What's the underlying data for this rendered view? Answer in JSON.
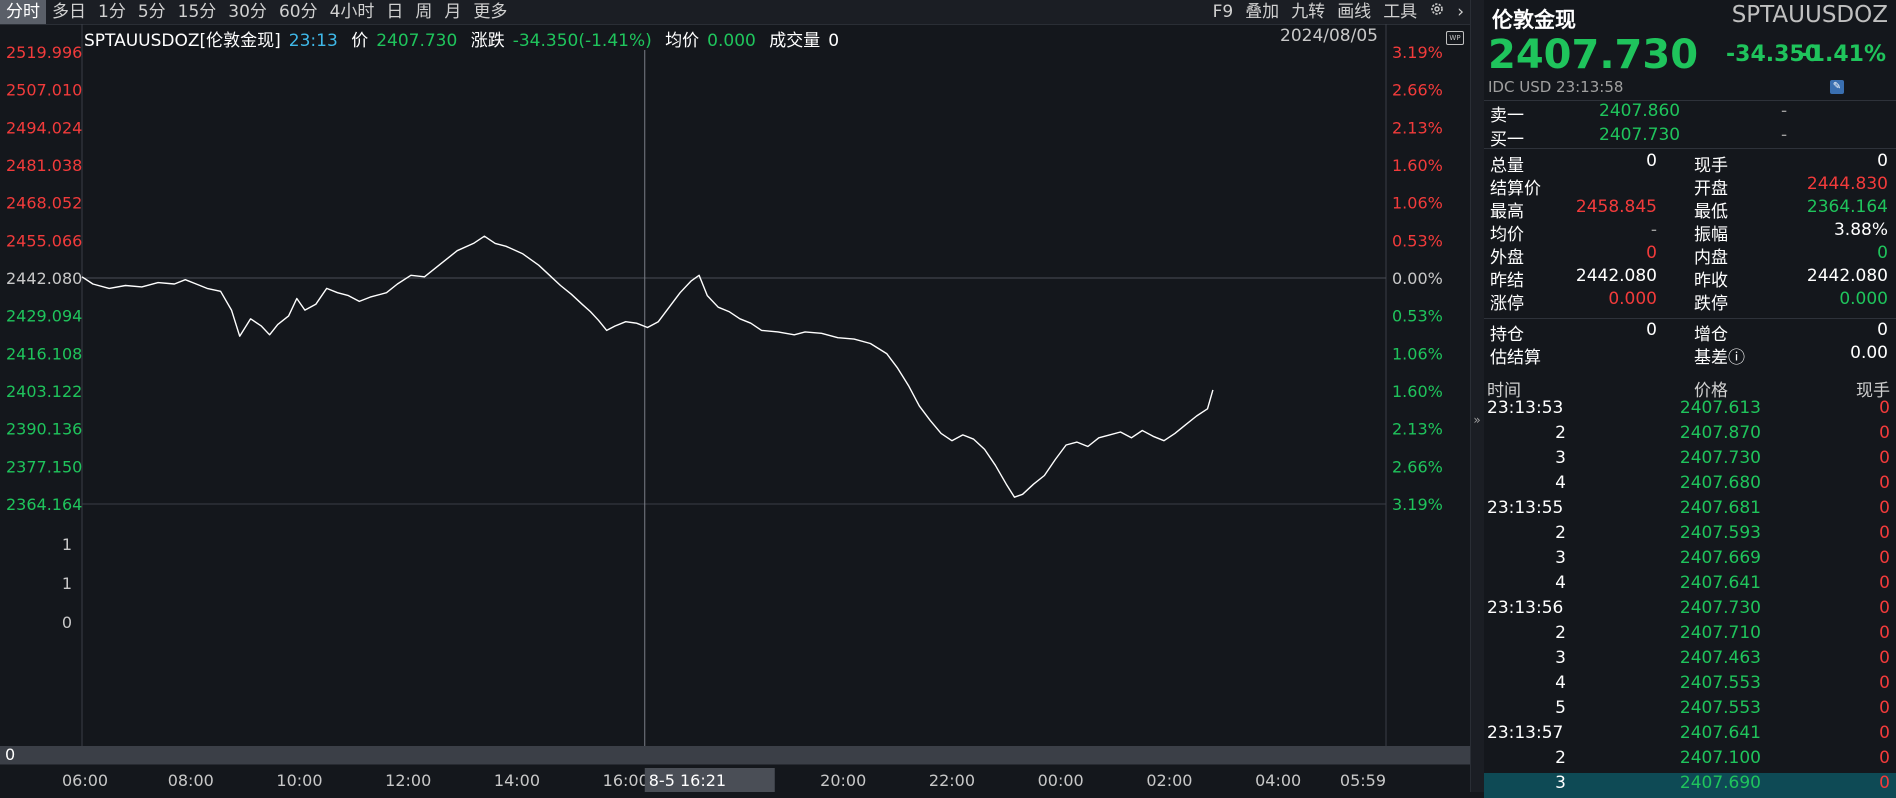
{
  "toolbar": {
    "periods": [
      "分时",
      "多日",
      "1分",
      "5分",
      "15分",
      "30分",
      "60分",
      "4小时",
      "日",
      "周",
      "月",
      "更多"
    ],
    "active_period": "分时",
    "tools": [
      "F9",
      "叠加",
      "九转",
      "画线",
      "工具"
    ],
    "gear_icon": "gear-icon",
    "more_icon": "chevron-right-icon"
  },
  "info": {
    "symbol": "SPTAUUSDOZ[伦敦金现]",
    "time": "23:13",
    "price_label": "价",
    "price": "2407.730",
    "change_label": "涨跌",
    "change": "-34.350(-1.41%)",
    "avg_label": "均价",
    "avg": "0.000",
    "volume_label": "成交量",
    "volume": "0",
    "date": "2024/08/05"
  },
  "chart_data": {
    "type": "line",
    "prev_close": 2442.08,
    "price_levels": [
      "2519.996",
      "2507.010",
      "2494.024",
      "2481.038",
      "2468.052",
      "2455.066",
      "2442.080",
      "2429.094",
      "2416.108",
      "2403.122",
      "2390.136",
      "2377.150",
      "2364.164"
    ],
    "pct_levels": [
      "3.19%",
      "2.66%",
      "2.13%",
      "1.60%",
      "1.06%",
      "0.53%",
      "0.00%",
      "0.53%",
      "1.06%",
      "1.60%",
      "2.13%",
      "2.66%",
      "3.19%"
    ],
    "volume_levels": [
      "1",
      "1",
      "0"
    ],
    "x_ticks": [
      "06:00",
      "08:00",
      "10:00",
      "12:00",
      "14:00",
      "16:00",
      "18:00",
      "20:00",
      "22:00",
      "00:00",
      "02:00",
      "04:00",
      "05:59"
    ],
    "x_hours": [
      6,
      8,
      10,
      12,
      14,
      16,
      18,
      20,
      22,
      24,
      26,
      28,
      29.983
    ],
    "ylim": [
      2364.164,
      2519.996
    ],
    "series": [
      {
        "points": [
          [
            6.0,
            2442.5
          ],
          [
            6.2,
            2440.0
          ],
          [
            6.5,
            2438.5
          ],
          [
            6.8,
            2439.5
          ],
          [
            7.1,
            2439.0
          ],
          [
            7.4,
            2440.5
          ],
          [
            7.7,
            2440.0
          ],
          [
            7.9,
            2441.5
          ],
          [
            8.1,
            2440.0
          ],
          [
            8.3,
            2438.5
          ],
          [
            8.55,
            2437.5
          ],
          [
            8.75,
            2431.0
          ],
          [
            8.9,
            2422.0
          ],
          [
            9.1,
            2428.0
          ],
          [
            9.3,
            2425.5
          ],
          [
            9.45,
            2422.5
          ],
          [
            9.6,
            2426.0
          ],
          [
            9.8,
            2429.0
          ],
          [
            9.95,
            2435.0
          ],
          [
            10.1,
            2431.0
          ],
          [
            10.3,
            2433.0
          ],
          [
            10.5,
            2438.5
          ],
          [
            10.7,
            2437.0
          ],
          [
            10.9,
            2436.0
          ],
          [
            11.1,
            2434.0
          ],
          [
            11.3,
            2435.5
          ],
          [
            11.6,
            2437.0
          ],
          [
            11.8,
            2440.0
          ],
          [
            12.05,
            2443.0
          ],
          [
            12.3,
            2442.5
          ],
          [
            12.6,
            2447.0
          ],
          [
            12.9,
            2451.5
          ],
          [
            13.2,
            2454.0
          ],
          [
            13.4,
            2456.5
          ],
          [
            13.6,
            2454.0
          ],
          [
            13.8,
            2453.0
          ],
          [
            14.1,
            2450.5
          ],
          [
            14.4,
            2446.5
          ],
          [
            14.6,
            2443.0
          ],
          [
            14.8,
            2439.5
          ],
          [
            15.0,
            2436.5
          ],
          [
            15.2,
            2433.0
          ],
          [
            15.35,
            2430.5
          ],
          [
            15.5,
            2427.5
          ],
          [
            15.65,
            2424.0
          ],
          [
            15.8,
            2425.5
          ],
          [
            16.0,
            2427.0
          ],
          [
            16.2,
            2426.5
          ],
          [
            16.4,
            2425.0
          ],
          [
            16.6,
            2427.0
          ],
          [
            16.8,
            2432.0
          ],
          [
            17.0,
            2437.0
          ],
          [
            17.2,
            2441.0
          ],
          [
            17.35,
            2443.0
          ],
          [
            17.5,
            2436.0
          ],
          [
            17.7,
            2432.0
          ],
          [
            17.9,
            2430.5
          ],
          [
            18.1,
            2428.0
          ],
          [
            18.3,
            2426.5
          ],
          [
            18.5,
            2424.0
          ],
          [
            18.8,
            2423.5
          ],
          [
            19.1,
            2422.5
          ],
          [
            19.3,
            2423.5
          ],
          [
            19.6,
            2423.0
          ],
          [
            19.9,
            2421.5
          ],
          [
            20.2,
            2421.0
          ],
          [
            20.5,
            2419.5
          ],
          [
            20.8,
            2416.0
          ],
          [
            21.0,
            2411.0
          ],
          [
            21.2,
            2405.0
          ],
          [
            21.4,
            2398.0
          ],
          [
            21.6,
            2393.0
          ],
          [
            21.8,
            2388.5
          ],
          [
            22.0,
            2386.0
          ],
          [
            22.2,
            2388.0
          ],
          [
            22.4,
            2386.5
          ],
          [
            22.6,
            2383.0
          ],
          [
            22.8,
            2377.5
          ],
          [
            23.0,
            2371.0
          ],
          [
            23.15,
            2366.5
          ],
          [
            23.3,
            2367.5
          ],
          [
            23.5,
            2371.0
          ],
          [
            23.7,
            2374.0
          ],
          [
            23.9,
            2379.5
          ],
          [
            24.1,
            2384.5
          ],
          [
            24.3,
            2385.5
          ],
          [
            24.5,
            2384.0
          ],
          [
            24.7,
            2387.0
          ],
          [
            24.9,
            2388.0
          ],
          [
            25.1,
            2389.0
          ],
          [
            25.3,
            2387.0
          ],
          [
            25.5,
            2389.5
          ],
          [
            25.7,
            2387.5
          ],
          [
            25.9,
            2386.0
          ],
          [
            26.1,
            2388.5
          ],
          [
            26.3,
            2391.5
          ],
          [
            26.5,
            2394.5
          ],
          [
            26.7,
            2397.0
          ],
          [
            26.8,
            2403.5
          ]
        ]
      }
    ]
  },
  "crosshair": {
    "time_label": "8-5 16:21",
    "value_label": "0"
  },
  "panel": {
    "name": "伦敦金现",
    "code": "SPTAUUSDOZ",
    "price": "2407.730",
    "change": "-34.350",
    "change_pct": "-1.41%",
    "meta": "IDC  USD  23:13:58",
    "ask_label": "卖一",
    "ask_price": "2407.860",
    "ask_vol": "-",
    "bid_label": "买一",
    "bid_price": "2407.730",
    "bid_vol": "-",
    "stats": [
      {
        "l1": "总量",
        "v1": "0",
        "c1": "white",
        "l2": "现手",
        "v2": "0",
        "c2": "white"
      },
      {
        "l1": "结算价",
        "v1": "",
        "c1": "white",
        "l2": "开盘",
        "v2": "2444.830",
        "c2": "red"
      },
      {
        "l1": "最高",
        "v1": "2458.845",
        "c1": "red",
        "l2": "最低",
        "v2": "2364.164",
        "c2": "green"
      },
      {
        "l1": "均价",
        "v1": "-",
        "c1": "gray",
        "l2": "振幅",
        "v2": "3.88%",
        "c2": "white"
      },
      {
        "l1": "外盘",
        "v1": "0",
        "c1": "red",
        "l2": "内盘",
        "v2": "0",
        "c2": "green"
      },
      {
        "l1": "昨结",
        "v1": "2442.080",
        "c1": "white",
        "l2": "昨收",
        "v2": "2442.080",
        "c2": "white"
      },
      {
        "l1": "涨停",
        "v1": "0.000",
        "c1": "red",
        "l2": "跌停",
        "v2": "0.000",
        "c2": "green"
      }
    ],
    "stats2": [
      {
        "l1": "持仓",
        "v1": "0",
        "c1": "white",
        "l2": "增仓",
        "v2": "0",
        "c2": "white"
      },
      {
        "l1": "估结算",
        "v1": "",
        "c1": "white",
        "l2": "基差ⓘ",
        "v2": "0.00",
        "c2": "white"
      }
    ],
    "ticks_header": {
      "time": "时间",
      "price": "价格",
      "vol": "现手"
    },
    "ticks": [
      {
        "time": "23:13:53",
        "price": "2407.613",
        "vol": "0"
      },
      {
        "time": "2",
        "price": "2407.870",
        "vol": "0"
      },
      {
        "time": "3",
        "price": "2407.730",
        "vol": "0"
      },
      {
        "time": "4",
        "price": "2407.680",
        "vol": "0"
      },
      {
        "time": "23:13:55",
        "price": "2407.681",
        "vol": "0"
      },
      {
        "time": "2",
        "price": "2407.593",
        "vol": "0"
      },
      {
        "time": "3",
        "price": "2407.669",
        "vol": "0"
      },
      {
        "time": "4",
        "price": "2407.641",
        "vol": "0"
      },
      {
        "time": "23:13:56",
        "price": "2407.730",
        "vol": "0"
      },
      {
        "time": "2",
        "price": "2407.710",
        "vol": "0"
      },
      {
        "time": "3",
        "price": "2407.463",
        "vol": "0"
      },
      {
        "time": "4",
        "price": "2407.553",
        "vol": "0"
      },
      {
        "time": "5",
        "price": "2407.553",
        "vol": "0"
      },
      {
        "time": "23:13:57",
        "price": "2407.641",
        "vol": "0"
      },
      {
        "time": "2",
        "price": "2407.100",
        "vol": "0"
      },
      {
        "time": "3",
        "price": "2407.690",
        "vol": "0"
      }
    ]
  }
}
